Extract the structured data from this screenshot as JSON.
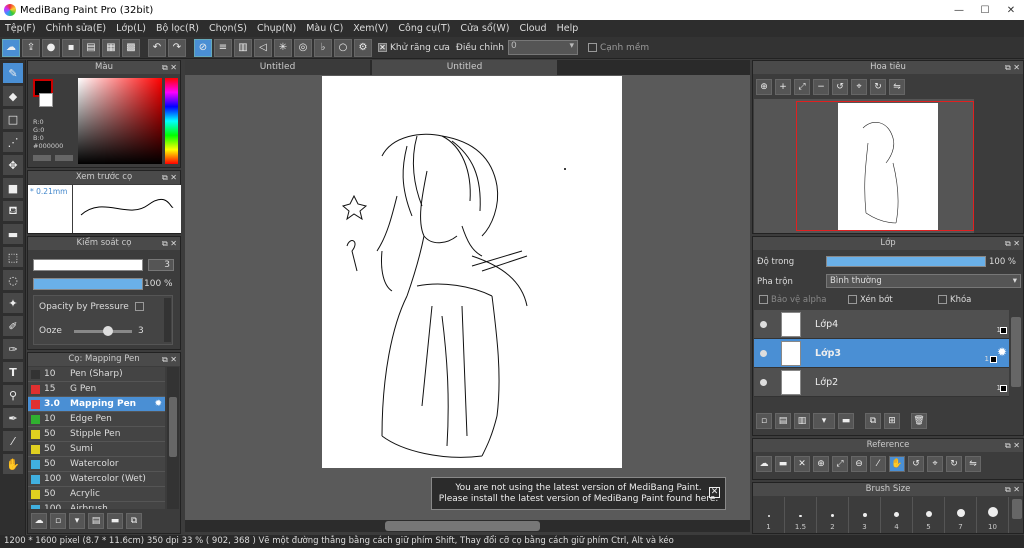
{
  "app": {
    "title": "MediBang Paint Pro (32bit)",
    "window_buttons": [
      "—",
      "☐",
      "✕"
    ]
  },
  "menu": [
    "Tệp(F)",
    "Chỉnh sửa(E)",
    "Lớp(L)",
    "Bộ lọc(R)",
    "Chọn(S)",
    "Chụp(N)",
    "Màu (C)",
    "Xem(V)",
    "Công cụ(T)",
    "Cửa sổ(W)",
    "Cloud",
    "Help"
  ],
  "toolbar": {
    "antialias_label": "Khử răng cưa",
    "correction_label": "Điều chỉnh",
    "correction_value": "0",
    "edge_label": "Cạnh mềm"
  },
  "tabs": [
    "Untitled",
    "Untitled"
  ],
  "color_panel": {
    "title": "Màu",
    "r": "R:0",
    "g": "G:0",
    "b": "B:0",
    "hex": "#000000",
    "primary_color": "#000000",
    "accent": "#cc0000"
  },
  "brush_preview": {
    "title": "Xem trước cọ",
    "size": "0.21mm"
  },
  "brush_control": {
    "title": "Kiểm soát cọ",
    "size_value": "3",
    "opacity_value": "100 %",
    "opacity_pressure_label": "Opacity by Pressure",
    "ooze_label": "Ooze",
    "ooze_value": "3"
  },
  "brush_list": {
    "title": "Cọ: Mapping Pen",
    "items": [
      {
        "size": "10",
        "name": "Pen (Sharp)",
        "color": "#333333"
      },
      {
        "size": "15",
        "name": "G Pen",
        "color": "#e03030"
      },
      {
        "size": "3.0",
        "name": "Mapping Pen",
        "color": "#e03030",
        "selected": true
      },
      {
        "size": "10",
        "name": "Edge Pen",
        "color": "#30b030"
      },
      {
        "size": "50",
        "name": "Stipple Pen",
        "color": "#e0d020"
      },
      {
        "size": "50",
        "name": "Sumi",
        "color": "#e0d020"
      },
      {
        "size": "50",
        "name": "Watercolor",
        "color": "#40b0e0"
      },
      {
        "size": "100",
        "name": "Watercolor (Wet)",
        "color": "#40b0e0"
      },
      {
        "size": "50",
        "name": "Acrylic",
        "color": "#e0d020"
      },
      {
        "size": "100",
        "name": "Airbrush",
        "color": "#40b0e0"
      }
    ]
  },
  "navigator": {
    "title": "Hoa tiêu"
  },
  "layer_panel": {
    "title": "Lớp",
    "opacity_label": "Độ trong",
    "opacity_value": "100 %",
    "blend_label": "Pha trộn",
    "blend_value": "Bình thường",
    "protect_alpha": "Bảo vệ alpha",
    "clipping": "Xén bớt",
    "lock": "Khóa",
    "layers": [
      {
        "name": "Lớp4",
        "selected": false
      },
      {
        "name": "Lớp3",
        "selected": true
      },
      {
        "name": "Lớp2",
        "selected": false
      }
    ],
    "layer_num": "1"
  },
  "reference": {
    "title": "Reference"
  },
  "brush_size": {
    "title": "Brush Size",
    "sizes": [
      "1",
      "1.5",
      "2",
      "3",
      "4",
      "5",
      "7",
      "10"
    ]
  },
  "notice": {
    "line1": "You are not using the latest version of MediBang Paint.",
    "line2": "Please install the latest version of MediBang Paint found here."
  },
  "status": {
    "text": "1200 * 1600 pixel  (8.7 * 11.6cm)  350 dpi  33 %  ( 902, 368 )  Vẽ một đường thẳng bằng cách giữ phím Shift, Thay đổi cỡ cọ bằng cách giữ phím Ctrl, Alt và kéo"
  }
}
